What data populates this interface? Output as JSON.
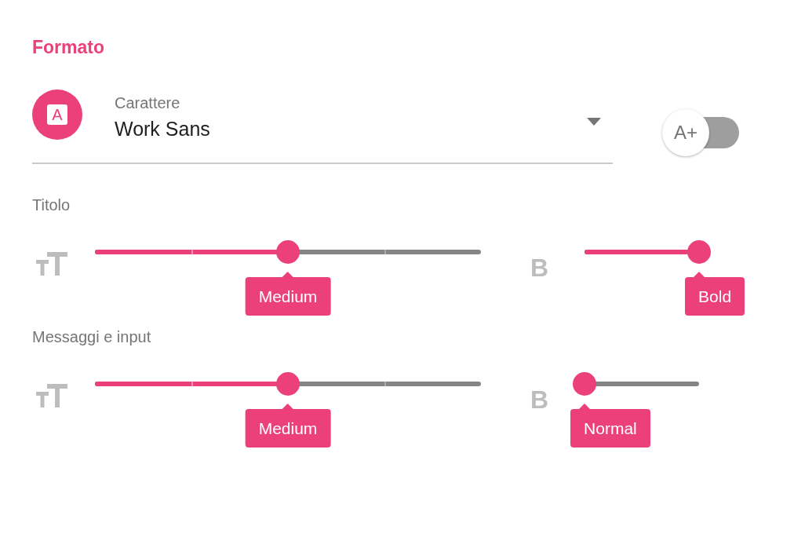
{
  "title": "Formato",
  "font_select": {
    "icon_letter": "A",
    "label": "Carattere",
    "value": "Work Sans"
  },
  "font_toggle": {
    "label": "A+",
    "on": false
  },
  "sections": [
    {
      "label": "Titolo",
      "size": {
        "kind": "stepped",
        "level": 0.5,
        "tooltip": "Medium"
      },
      "weight": {
        "icon_letter": "B",
        "kind": "continuous",
        "level": 1,
        "tooltip": "Bold"
      }
    },
    {
      "label": "Messaggi e input",
      "size": {
        "kind": "stepped",
        "level": 0.5,
        "tooltip": "Medium"
      },
      "weight": {
        "icon_letter": "B",
        "kind": "continuous",
        "level": 0,
        "tooltip": "Normal"
      }
    }
  ]
}
